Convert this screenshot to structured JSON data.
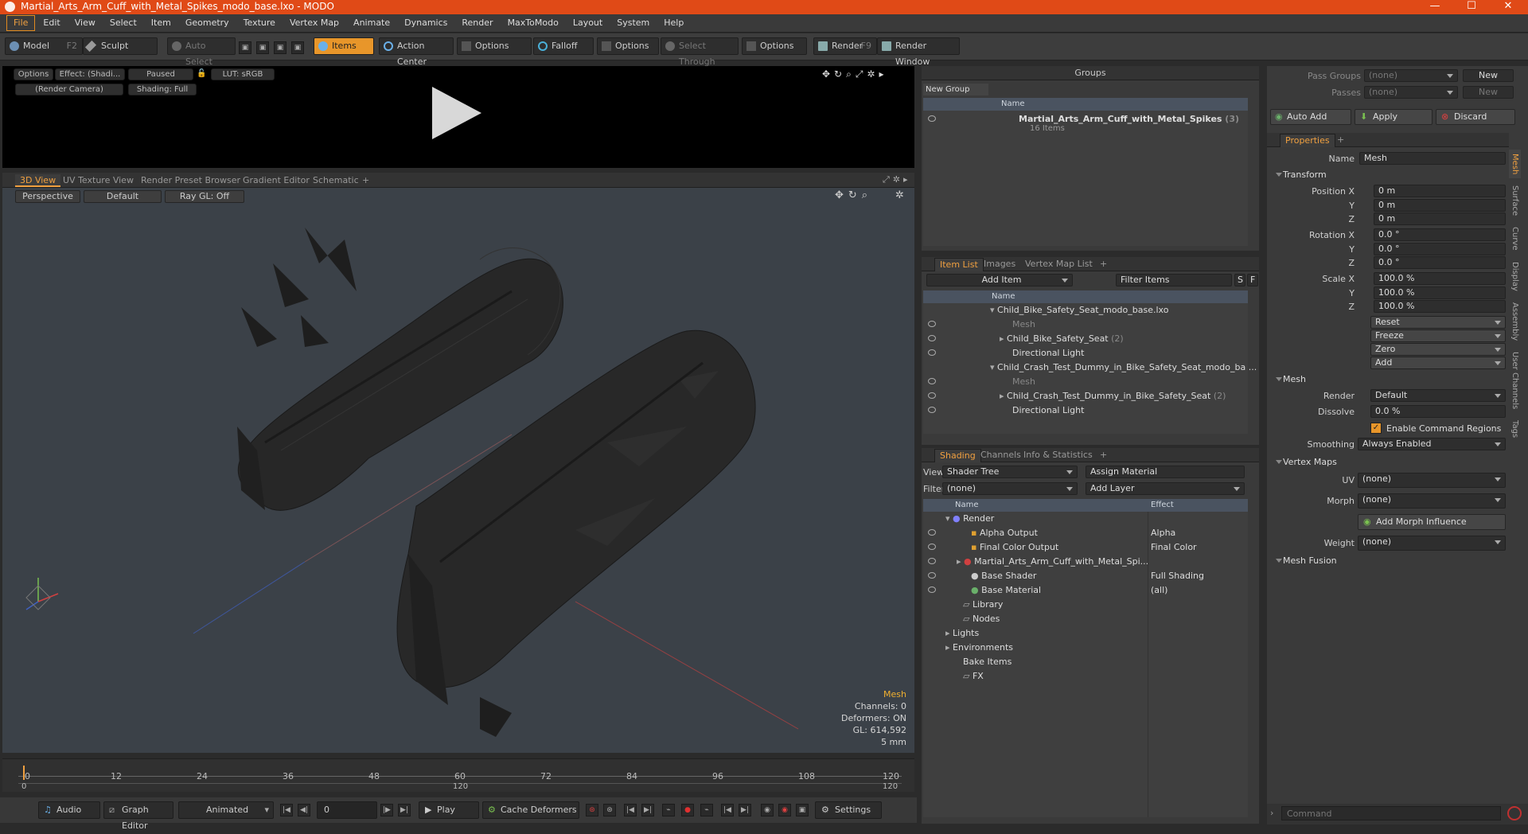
{
  "window": {
    "title": "Martial_Arts_Arm_Cuff_with_Metal_Spikes_modo_base.lxo - MODO",
    "minimize": "—",
    "maximize": "☐",
    "close": "✕"
  },
  "menu": [
    "File",
    "Edit",
    "View",
    "Select",
    "Item",
    "Geometry",
    "Texture",
    "Vertex Map",
    "Animate",
    "Dynamics",
    "Render",
    "MaxToModo",
    "Layout",
    "System",
    "Help"
  ],
  "toolbar": {
    "model": "Model",
    "model_key": "F2",
    "sculpt": "Sculpt",
    "auto_select": "Auto Select",
    "items": "Items",
    "action_center": "Action Center",
    "options1": "Options",
    "falloff": "Falloff",
    "options2": "Options",
    "select_through": "Select Through",
    "options3": "Options",
    "render": "Render",
    "render_key": "F9",
    "render_window": "Render Window"
  },
  "preview": {
    "options": "Options",
    "effect": "Effect: (Shadi...",
    "paused": "Paused",
    "lut": "LUT: sRGB",
    "camera": "(Render Camera)",
    "shading": "Shading: Full"
  },
  "viewport_tabs": [
    "3D View",
    "UV Texture View",
    "Render Preset Browser",
    "Gradient Editor",
    "Schematic",
    "+"
  ],
  "viewport": {
    "perspective": "Perspective",
    "default": "Default",
    "raygl": "Ray GL: Off"
  },
  "vpinfo": {
    "mesh": "Mesh",
    "channels": "Channels: 0",
    "deformers": "Deformers: ON",
    "gl": "GL: 614,592",
    "scale": "5 mm"
  },
  "timeline": {
    "ticks": [
      "0",
      "12",
      "24",
      "36",
      "48",
      "60",
      "72",
      "84",
      "96",
      "108",
      "120"
    ],
    "range_start": "0",
    "range_mid": "120",
    "range_end": "120"
  },
  "bottom": {
    "audio": "Audio",
    "graph_editor": "Graph Editor",
    "animated": "Animated",
    "frame": "0",
    "play": "Play",
    "cache": "Cache Deformers",
    "settings": "Settings"
  },
  "groups": {
    "title": "Groups",
    "new_group": "New Group",
    "col_name": "Name",
    "item_name": "Martial_Arts_Arm_Cuff_with_Metal_Spikes",
    "item_count": "(3)",
    "item_sub": "16 Items"
  },
  "itemlist": {
    "tabs": [
      "Item List",
      "Images",
      "Vertex Map List",
      "+"
    ],
    "add_item": "Add Item",
    "filter_items": "Filter Items",
    "s": "S",
    "f": "F",
    "col_name": "Name",
    "rows": [
      {
        "name": "Child_Bike_Safety_Seat_modo_base.lxo",
        "count": ""
      },
      {
        "name": "Mesh",
        "count": ""
      },
      {
        "name": "Child_Bike_Safety_Seat",
        "count": "(2)"
      },
      {
        "name": "Directional Light",
        "count": ""
      },
      {
        "name": "Child_Crash_Test_Dummy_in_Bike_Safety_Seat_modo_ba ...",
        "count": ""
      },
      {
        "name": "Mesh",
        "count": ""
      },
      {
        "name": "Child_Crash_Test_Dummy_in_Bike_Safety_Seat",
        "count": "(2)"
      },
      {
        "name": "Directional Light",
        "count": ""
      }
    ]
  },
  "shading": {
    "tabs": [
      "Shading",
      "Channels",
      "Info & Statistics",
      "+"
    ],
    "view_label": "View",
    "view_value": "Shader Tree",
    "assign_material": "Assign Material",
    "filter_label": "Filter",
    "filter_value": "(none)",
    "add_layer": "Add Layer",
    "col_name": "Name",
    "col_effect": "Effect",
    "rows": [
      {
        "name": "Render",
        "effect": ""
      },
      {
        "name": "Alpha Output",
        "effect": "Alpha"
      },
      {
        "name": "Final Color Output",
        "effect": "Final Color"
      },
      {
        "name": "Martial_Arts_Arm_Cuff_with_Metal_Spi...",
        "effect": ""
      },
      {
        "name": "Base Shader",
        "effect": "Full Shading"
      },
      {
        "name": "Base Material",
        "effect": "(all)"
      },
      {
        "name": "Library",
        "effect": ""
      },
      {
        "name": "Nodes",
        "effect": ""
      },
      {
        "name": "Lights",
        "effect": ""
      },
      {
        "name": "Environments",
        "effect": ""
      },
      {
        "name": "Bake Items",
        "effect": ""
      },
      {
        "name": "FX",
        "effect": ""
      }
    ]
  },
  "passes": {
    "pass_groups": "Pass Groups",
    "passes": "Passes",
    "none1": "(none)",
    "none2": "(none)",
    "new1": "New",
    "new2": "New",
    "auto_add": "Auto Add",
    "apply": "Apply",
    "discard": "Discard"
  },
  "properties": {
    "tab": "Properties",
    "plus": "+",
    "name_label": "Name",
    "name_value": "Mesh",
    "transform": "Transform",
    "position_x": "Position X",
    "y": "Y",
    "z": "Z",
    "pos": [
      "0 m",
      "0 m",
      "0 m"
    ],
    "rotation_x": "Rotation X",
    "rot": [
      "0.0 °",
      "0.0 °",
      "0.0 °"
    ],
    "scale_x": "Scale X",
    "scl": [
      "100.0 %",
      "100.0 %",
      "100.0 %"
    ],
    "reset": "Reset",
    "freeze": "Freeze",
    "zero": "Zero",
    "add": "Add",
    "mesh": "Mesh",
    "render_label": "Render",
    "render_value": "Default",
    "dissolve_label": "Dissolve",
    "dissolve_value": "0.0 %",
    "cmd_regions": "Enable Command Regions",
    "smoothing_label": "Smoothing",
    "smoothing_value": "Always Enabled",
    "vertex_maps": "Vertex Maps",
    "uv_label": "UV",
    "uv_value": "(none)",
    "morph_label": "Morph",
    "morph_value": "(none)",
    "add_morph": "Add Morph Influence",
    "weight_label": "Weight",
    "weight_value": "(none)",
    "mesh_fusion": "Mesh Fusion"
  },
  "side_tabs": [
    "Mesh",
    "Surface",
    "Curve",
    "Display",
    "Assembly",
    "User Channels",
    "Tags"
  ],
  "command": {
    "placeholder": "Command"
  },
  "colors": {
    "title_bar": "#e04a17",
    "accent": "#f0a040",
    "viewport_bg": "#3b4148"
  }
}
